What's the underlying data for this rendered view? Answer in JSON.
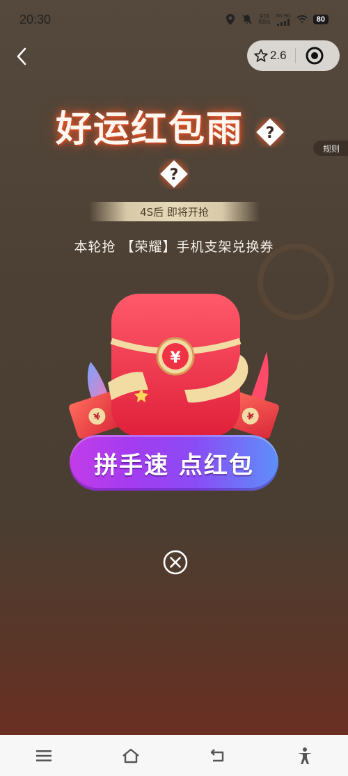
{
  "status_bar": {
    "time": "20:30",
    "net_speed_value": "978",
    "net_speed_unit": "KB/s",
    "signal_label": "5G HD",
    "battery": "80"
  },
  "capsule": {
    "rating": "2.6"
  },
  "rules_label": "规则",
  "title": "好运红包雨",
  "countdown": "4S后 即将开抢",
  "prize_text": "本轮抢 【荣耀】手机支架兑换券",
  "packet_symbol": "¥",
  "cta_label": "拼手速 点红包",
  "colors": {
    "cta_start": "#c23ce8",
    "cta_end": "#5e8ffa",
    "packet_red": "#f0344a",
    "ribbon_gold": "#f3dca4"
  },
  "icons": [
    "back-icon",
    "star-icon",
    "target-icon",
    "question-icon",
    "close-circle-icon",
    "menu-icon",
    "home-icon",
    "return-icon",
    "accessibility-icon"
  ]
}
